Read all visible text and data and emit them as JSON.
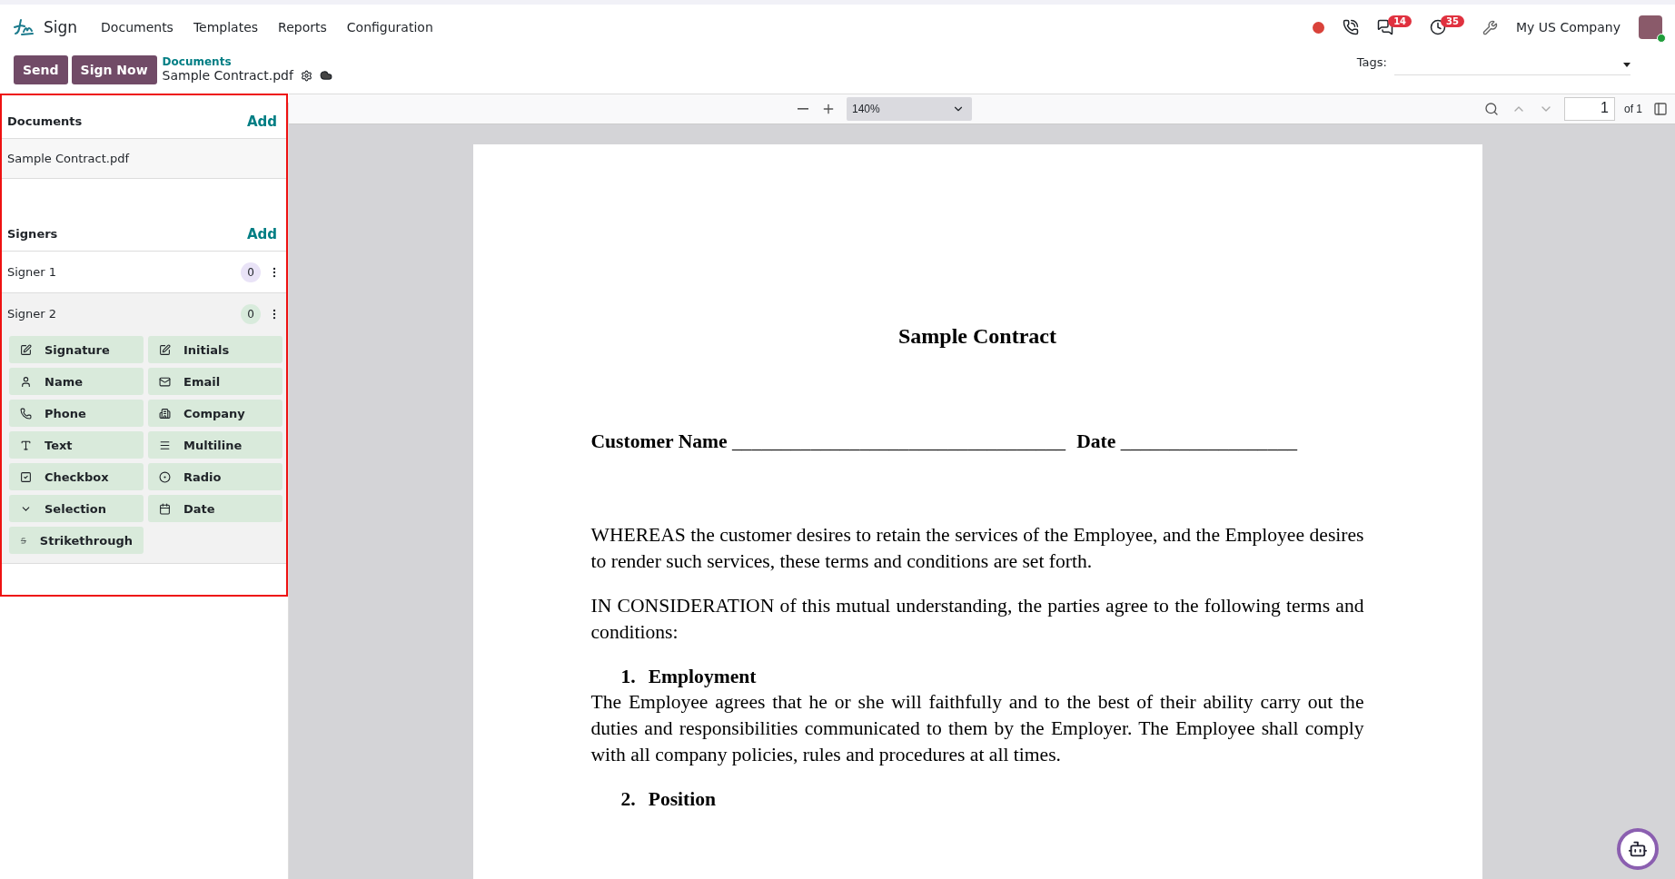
{
  "app": {
    "name": "Sign"
  },
  "menu": [
    "Documents",
    "Templates",
    "Reports",
    "Configuration"
  ],
  "systray": {
    "message_count": "14",
    "activity_count": "35",
    "company": "My US Company"
  },
  "actions": [
    "Send",
    "Sign Now"
  ],
  "breadcrumb": {
    "parent": "Documents",
    "current": "Sample Contract.pdf"
  },
  "tags": {
    "label": "Tags:"
  },
  "sidebar": {
    "documents": {
      "title": "Documents",
      "add": "Add",
      "items": [
        "Sample Contract.pdf"
      ]
    },
    "signers": {
      "title": "Signers",
      "add": "Add",
      "items": [
        {
          "name": "Signer 1",
          "count": "0",
          "color": "#e9e3f7",
          "expanded": false
        },
        {
          "name": "Signer 2",
          "count": "0",
          "color": "#d8ebdc",
          "expanded": true,
          "fields": [
            {
              "label": "Signature",
              "kind": "signature"
            },
            {
              "label": "Initials",
              "kind": "initials"
            },
            {
              "label": "Name",
              "kind": "name"
            },
            {
              "label": "Email",
              "kind": "email"
            },
            {
              "label": "Phone",
              "kind": "phone"
            },
            {
              "label": "Company",
              "kind": "company"
            },
            {
              "label": "Text",
              "kind": "text"
            },
            {
              "label": "Multiline",
              "kind": "multiline"
            },
            {
              "label": "Checkbox",
              "kind": "checkbox"
            },
            {
              "label": "Radio",
              "kind": "radio"
            },
            {
              "label": "Selection",
              "kind": "selection"
            },
            {
              "label": "Date",
              "kind": "date"
            },
            {
              "label": "Strikethrough",
              "kind": "strikethrough"
            }
          ]
        }
      ]
    }
  },
  "viewer": {
    "zoom": "140%",
    "page": "1",
    "page_count": "of 1"
  },
  "document": {
    "title": "Sample Contract",
    "blanks": [
      {
        "label": "Customer Name",
        "line": "__________________________________"
      },
      {
        "label": "Date",
        "line": "__________________"
      }
    ],
    "blocks": [
      {
        "kind": "paragraph",
        "text": "WHEREAS the customer desires to retain the services of the Employee, and the Employee desires to render such services, these terms and conditions are set forth."
      },
      {
        "kind": "paragraph",
        "text": "IN CONSIDERATION of this mutual understanding, the parties agree to the following terms and conditions:"
      },
      {
        "kind": "heading",
        "number": "1.",
        "text": "Employment"
      },
      {
        "kind": "paragraph",
        "text": "The Employee agrees that he or she will faithfully and to the best of their ability carry out the duties and responsibilities communicated to them by the Employer. The Employee shall comply with all company policies, rules and procedures at all times."
      },
      {
        "kind": "heading",
        "number": "2.",
        "text": "Position"
      }
    ]
  }
}
